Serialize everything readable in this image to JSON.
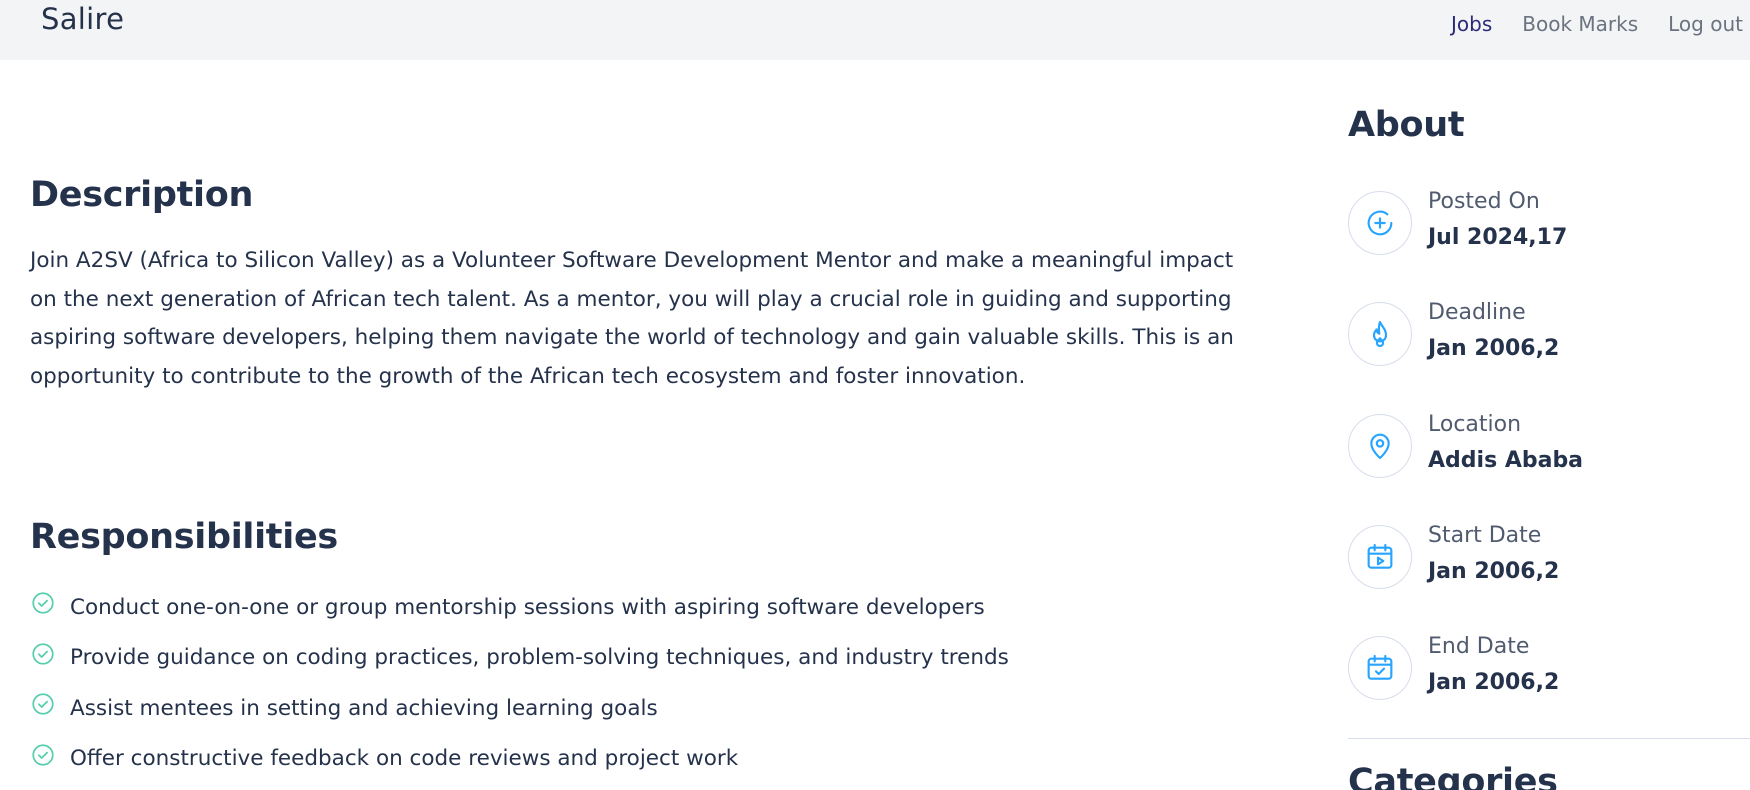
{
  "navbar": {
    "brand": "Salire",
    "links": [
      {
        "label": "Jobs",
        "active": true
      },
      {
        "label": "Book Marks",
        "active": false
      },
      {
        "label": "Log out",
        "active": false
      }
    ]
  },
  "main": {
    "description": {
      "title": "Description",
      "text": "Join A2SV (Africa to Silicon Valley) as a Volunteer Software Development Mentor and make a meaningful impact on the next generation of African tech talent. As a mentor, you will play a crucial role in guiding and supporting aspiring software developers, helping them navigate the world of technology and gain valuable skills. This is an opportunity to contribute to the growth of the African tech ecosystem and foster innovation."
    },
    "responsibilities": {
      "title": "Responsibilities",
      "items": [
        "Conduct one-on-one or group mentorship sessions with aspiring software developers",
        "Provide guidance on coding practices, problem-solving techniques, and industry trends",
        "Assist mentees in setting and achieving learning goals",
        "Offer constructive feedback on code reviews and project work"
      ]
    }
  },
  "sidebar": {
    "about_title": "About",
    "items": [
      {
        "label": "Posted On",
        "value": "Jul 2024,17",
        "icon": "plus-circle-icon"
      },
      {
        "label": "Deadline",
        "value": "Jan 2006,2",
        "icon": "fire-icon"
      },
      {
        "label": "Location",
        "value": "Addis Ababa",
        "icon": "location-pin-icon"
      },
      {
        "label": "Start Date",
        "value": "Jan 2006,2",
        "icon": "calendar-play-icon"
      },
      {
        "label": "End Date",
        "value": "Jan 2006,2",
        "icon": "calendar-check-icon"
      }
    ],
    "categories_title": "Categories"
  },
  "colors": {
    "heading": "#25324B",
    "check_icon": "#56CDAD",
    "about_icon": "#26A4FF",
    "nav_active": "#2d2a7a",
    "nav_bg": "#f3f4f6"
  }
}
